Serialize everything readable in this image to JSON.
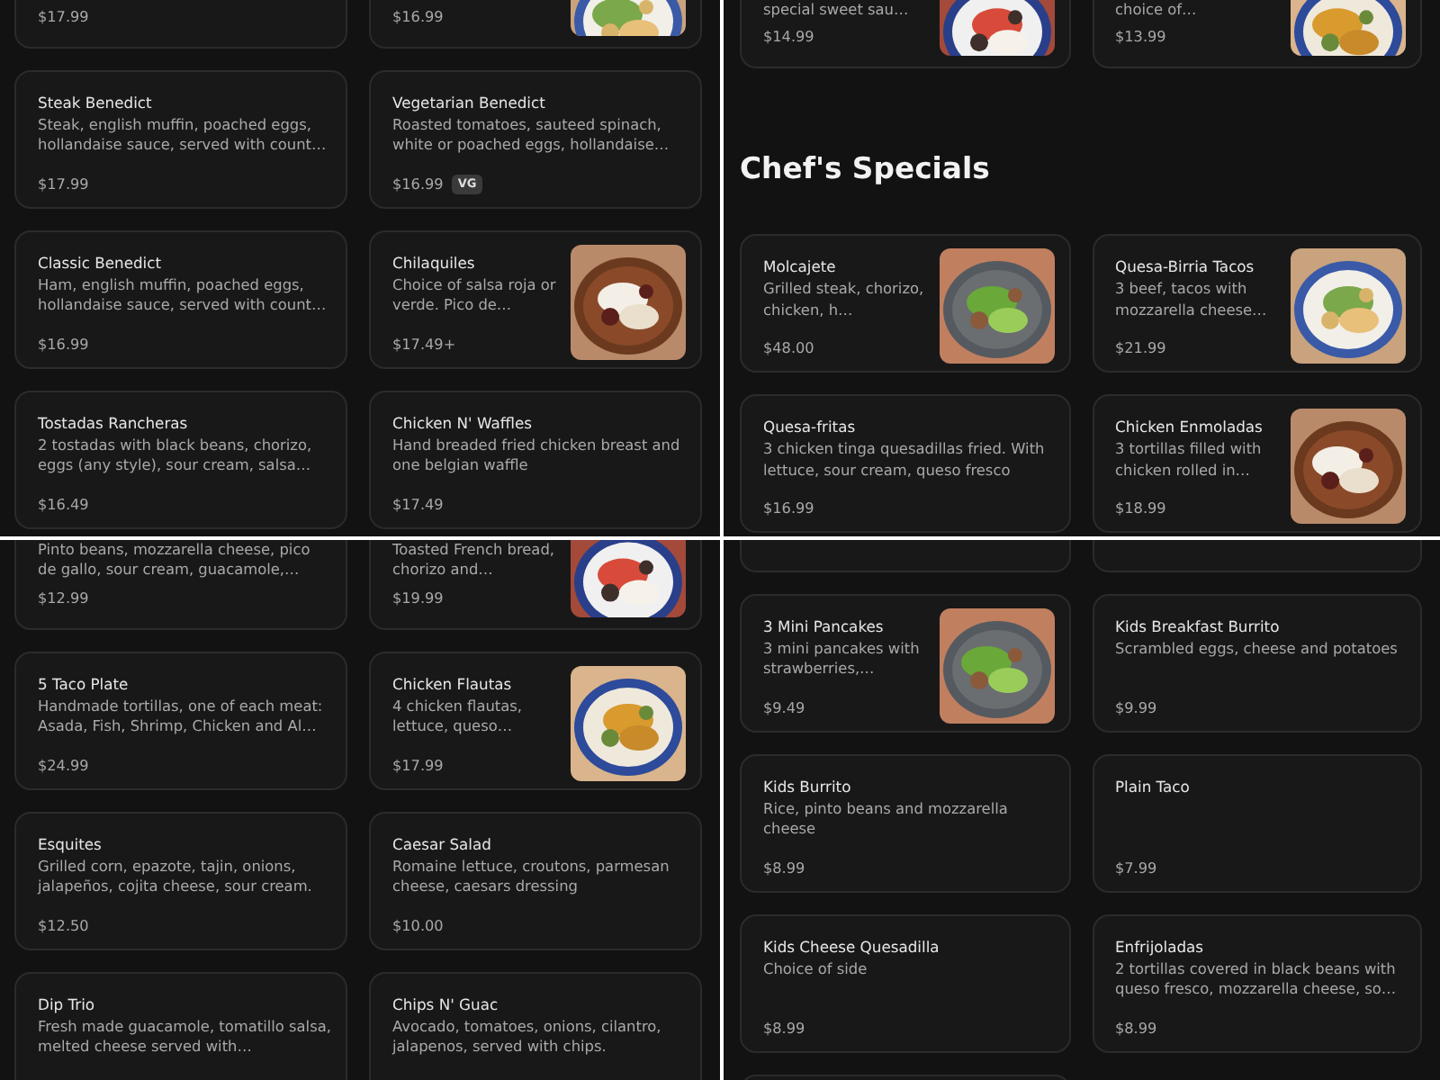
{
  "panels": [
    {
      "sections": [
        {
          "items": [
            {
              "cut_top": true,
              "price": "$17.99"
            },
            {
              "cut_top": true,
              "price": "$16.99"
            },
            {
              "name": "Steak Benedict",
              "description": "Steak, english muffin, poached eggs, hollandaise sauce, served with count…",
              "price": "$17.99"
            },
            {
              "name": "Vegetarian Benedict",
              "description": "Roasted tomatoes, sauteed spinach, white or poached eggs, hollandaise…",
              "price": "$16.99",
              "badge": "VG"
            },
            {
              "name": "Classic Benedict",
              "description": "Ham, english muffin, poached eggs, hollandaise sauce, served with count…",
              "price": "$16.99"
            },
            {
              "name": "Chilaquiles",
              "description": "Choice of salsa roja or verde. Pico de…",
              "price": "$17.49+"
            },
            {
              "name": "Tostadas Rancheras",
              "description": "2 tostadas with black beans, chorizo, eggs (any style), sour cream, salsa…",
              "price": "$16.49"
            },
            {
              "name": "Chicken N' Waffles",
              "description": "Hand breaded fried chicken breast and one belgian waffle",
              "price": "$17.49"
            }
          ]
        }
      ]
    },
    {
      "sections": [
        {
          "items": [
            {
              "cut_top": true,
              "description": "special sweet sau…",
              "price": "$14.99"
            },
            {
              "cut_top": true,
              "description": "choice of…",
              "price": "$13.99"
            }
          ]
        },
        {
          "heading": "Chef's Specials",
          "items": [
            {
              "name": "Molcajete",
              "description": "Grilled steak, chorizo, chicken, h…",
              "price": "$48.00"
            },
            {
              "name": "Quesa-Birria Tacos",
              "description": "3 beef, tacos with mozzarella cheese…",
              "price": "$21.99"
            },
            {
              "name": "Quesa-fritas",
              "description": "3 chicken tinga quesadillas fried. With lettuce, sour cream, queso fresco",
              "price": "$16.99"
            },
            {
              "name": "Chicken Enmoladas",
              "description": "3 tortillas filled with chicken rolled in…",
              "price": "$18.99"
            }
          ]
        }
      ]
    },
    {
      "sections": [
        {
          "items": [
            {
              "cut_top": true,
              "description": "Pinto beans, mozzarella cheese, pico de gallo, sour cream, guacamole,…",
              "price": "$12.99"
            },
            {
              "cut_top": true,
              "description": "Toasted French bread, chorizo and…",
              "price": "$19.99"
            },
            {
              "name": "5 Taco Plate",
              "description": "Handmade tortillas, one of each meat: Asada, Fish, Shrimp, Chicken and Al…",
              "price": "$24.99"
            },
            {
              "name": "Chicken Flautas",
              "description": "4 chicken flautas, lettuce, queso…",
              "price": "$17.99"
            },
            {
              "name": "Esquites",
              "description": "Grilled corn, epazote, tajin, onions, jalapeños, cojita cheese, sour cream.",
              "price": "$12.50"
            },
            {
              "name": "Caesar Salad",
              "description": "Romaine lettuce, croutons, parmesan cheese, caesars dressing",
              "price": "$10.00"
            },
            {
              "cut_bottom": true,
              "name": "Dip Trio",
              "description": "Fresh made guacamole, tomatillo salsa, melted cheese served with…"
            },
            {
              "cut_bottom": true,
              "name": "Chips N' Guac",
              "description": "Avocado, tomatoes, onions, cilantro, jalapenos, served with chips."
            }
          ]
        }
      ]
    },
    {
      "sections": [
        {
          "items": [
            {
              "cut_top": true
            },
            {
              "cut_top": true
            },
            {
              "name": "3 Mini Pancakes",
              "description": "3 mini pancakes with strawberries,…",
              "price": "$9.49"
            },
            {
              "name": "Kids Breakfast Burrito",
              "description": "Scrambled eggs, cheese and potatoes",
              "price": "$9.99"
            },
            {
              "name": "Kids Burrito",
              "description": "Rice, pinto beans and mozzarella cheese",
              "price": "$8.99"
            },
            {
              "name": "Plain Taco",
              "price": "$7.99"
            },
            {
              "name": "Kids Cheese Quesadilla",
              "description": "Choice of side",
              "price": "$8.99"
            },
            {
              "name": "Enfrijoladas",
              "description": "2 tortillas covered in black beans with queso fresco, mozzarella cheese, so…",
              "price": "$8.99"
            },
            {
              "cut_bottom": true
            }
          ]
        }
      ]
    }
  ]
}
